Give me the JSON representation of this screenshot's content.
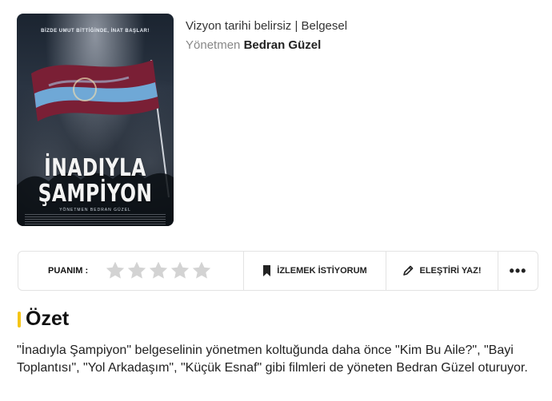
{
  "poster": {
    "tagline": "BİZDE UMUT BİTTİĞİNDE, İNAT BAŞLAR!",
    "title_line1": "İNADIYLA",
    "title_line2": "ŞAMPİYON",
    "director_credit": "YÖNETMEN  BEDRAN GÜZEL"
  },
  "movie": {
    "release": "Vizyon tarihi belirsiz",
    "separator": "|",
    "genre": "Belgesel",
    "director_label": "Yönetmen",
    "director_name": "Bedran Güzel"
  },
  "actions": {
    "rating_label": "PUANIM :",
    "rating_value": 0,
    "rating_max": 5,
    "watchlist_label": "İZLEMEK İSTİYORUM",
    "review_label": "ELEŞTİRİ YAZ!",
    "more_label": "•••"
  },
  "summary": {
    "heading": "Özet",
    "text": "\"İnadıyla Şampiyon\" belgeselinin yönetmen koltuğunda daha önce \"Kim Bu Aile?\", \"Bayi Toplantısı\", \"Yol Arkadaşım\", \"Küçük Esnaf\" gibi filmleri de yöneten Bedran Güzel oturuyor."
  },
  "colors": {
    "accent": "#f5c518",
    "star_empty": "#d3d3d3",
    "flag_claret": "#7a1f35",
    "flag_blue": "#6fa8d6"
  }
}
